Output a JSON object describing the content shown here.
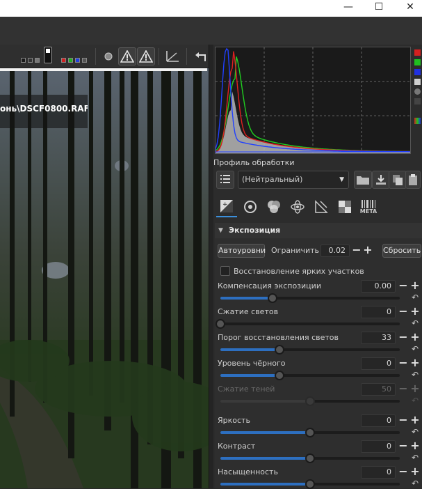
{
  "window": {
    "minimize_glyph": "—",
    "maximize_glyph": "☐",
    "close_glyph": "✕"
  },
  "image": {
    "filename": "онь\\DSCF0800.RAF"
  },
  "processing_profile": {
    "label": "Профиль обработки",
    "selected": "(Нейтральный)"
  },
  "tabs": [
    {
      "icon": "exposure-icon",
      "active": true
    },
    {
      "icon": "detail-icon"
    },
    {
      "icon": "color-icon"
    },
    {
      "icon": "advanced-icon"
    },
    {
      "icon": "transform-icon"
    },
    {
      "icon": "raw-icon"
    },
    {
      "icon": "meta-icon",
      "label": "META"
    }
  ],
  "exposure": {
    "title": "Экспозиция",
    "auto_levels": "Автоуровни",
    "clip_label": "Ограничить",
    "clip_value": "0.02",
    "reset_button": "Сбросить",
    "highlight_recovery": "Восстановление ярких участков",
    "sliders": [
      {
        "name": "exposure-compensation",
        "label": "Компенсация экспозиции",
        "value": "0.00",
        "position": 0.29,
        "enabled": true
      },
      {
        "name": "highlight-compression",
        "label": "Сжатие светов",
        "value": "0",
        "position": 0.0,
        "enabled": true
      },
      {
        "name": "highlight-threshold",
        "label": "Порог восстановления светов",
        "value": "33",
        "position": 0.33,
        "enabled": true
      },
      {
        "name": "black-level",
        "label": "Уровень чёрного",
        "value": "0",
        "position": 0.33,
        "enabled": true
      },
      {
        "name": "shadow-compression",
        "label": "Сжатие теней",
        "value": "50",
        "position": 0.5,
        "enabled": false
      },
      {
        "name": "lightness",
        "label": "Яркость",
        "value": "0",
        "position": 0.5,
        "enabled": true
      },
      {
        "name": "contrast",
        "label": "Контраст",
        "value": "0",
        "position": 0.5,
        "enabled": true
      },
      {
        "name": "saturation",
        "label": "Насыщенность",
        "value": "0",
        "position": 0.5,
        "enabled": true
      }
    ]
  },
  "colors": {
    "accent": "#2d6fc0",
    "histogram_red": "#e02020",
    "histogram_green": "#20d020",
    "histogram_blue": "#2040ff",
    "histogram_luma": "#c8c8c8"
  }
}
